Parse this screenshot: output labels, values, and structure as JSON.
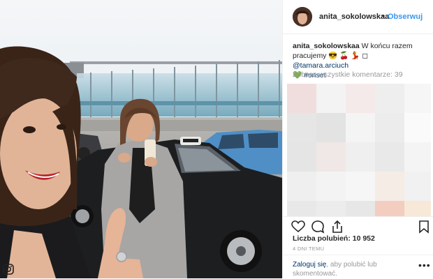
{
  "header": {
    "username": "anita_sokolowskaa",
    "separator": "•",
    "follow_label": "Obserwuj"
  },
  "caption": {
    "username": "anita_sokolowskaa",
    "text_part1": "W końcu razem pracujemy",
    "emoji": "😎 🍒 💃 ◻",
    "mention": "@tamara.arciuch",
    "heart": "💚",
    "hashtag": "#onset"
  },
  "comments": {
    "view_all_label": "Zobacz wszystkie komentarze: 39"
  },
  "stats": {
    "likes_label": "Liczba polubień: 10 952",
    "time_ago": "4 DNI TEMU"
  },
  "footer": {
    "login_link": "Zaloguj się",
    "login_rest": ", aby polubić lub skomentować.",
    "more_label": "•••"
  },
  "icons": {
    "like": "heart-icon",
    "comment": "comment-icon",
    "share": "share-icon",
    "save": "bookmark-icon",
    "more": "more-options-icon"
  },
  "colors": {
    "follow": "#3897f0",
    "link": "#003569",
    "muted": "#999999",
    "text": "#262626"
  }
}
